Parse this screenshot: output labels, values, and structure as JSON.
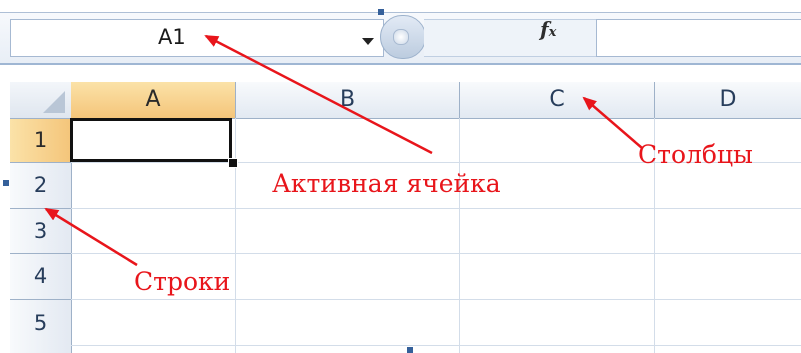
{
  "formula_bar": {
    "name_box_value": "A1",
    "fx_label": "f",
    "fx_sub": "x",
    "formula_value": ""
  },
  "columns": [
    "A",
    "B",
    "C",
    "D"
  ],
  "rows": [
    "1",
    "2",
    "3",
    "4",
    "5"
  ],
  "active_cell": "A1",
  "annotations": {
    "active_cell": "Активная ячейка",
    "columns": "Столбцы",
    "rows": "Строки"
  },
  "colors": {
    "annotation": "#e8151b",
    "active_header": "#f4c57a",
    "header": "#e2e9f2",
    "gridline": "#d3dde9"
  }
}
